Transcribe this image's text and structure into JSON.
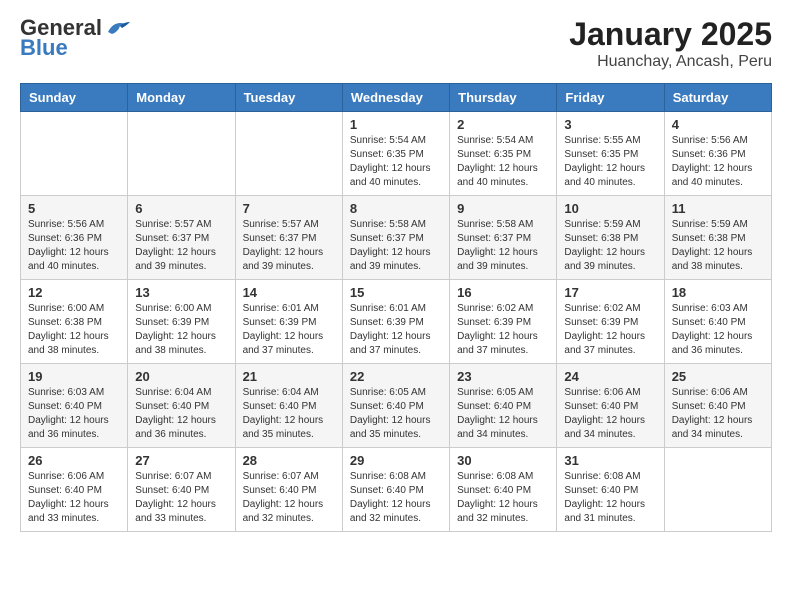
{
  "header": {
    "logo_general": "General",
    "logo_blue": "Blue",
    "title": "January 2025",
    "subtitle": "Huanchay, Ancash, Peru"
  },
  "weekdays": [
    "Sunday",
    "Monday",
    "Tuesday",
    "Wednesday",
    "Thursday",
    "Friday",
    "Saturday"
  ],
  "weeks": [
    [
      {
        "day": "",
        "sunrise": "",
        "sunset": "",
        "daylight": ""
      },
      {
        "day": "",
        "sunrise": "",
        "sunset": "",
        "daylight": ""
      },
      {
        "day": "",
        "sunrise": "",
        "sunset": "",
        "daylight": ""
      },
      {
        "day": "1",
        "sunrise": "Sunrise: 5:54 AM",
        "sunset": "Sunset: 6:35 PM",
        "daylight": "Daylight: 12 hours and 40 minutes."
      },
      {
        "day": "2",
        "sunrise": "Sunrise: 5:54 AM",
        "sunset": "Sunset: 6:35 PM",
        "daylight": "Daylight: 12 hours and 40 minutes."
      },
      {
        "day": "3",
        "sunrise": "Sunrise: 5:55 AM",
        "sunset": "Sunset: 6:35 PM",
        "daylight": "Daylight: 12 hours and 40 minutes."
      },
      {
        "day": "4",
        "sunrise": "Sunrise: 5:56 AM",
        "sunset": "Sunset: 6:36 PM",
        "daylight": "Daylight: 12 hours and 40 minutes."
      }
    ],
    [
      {
        "day": "5",
        "sunrise": "Sunrise: 5:56 AM",
        "sunset": "Sunset: 6:36 PM",
        "daylight": "Daylight: 12 hours and 40 minutes."
      },
      {
        "day": "6",
        "sunrise": "Sunrise: 5:57 AM",
        "sunset": "Sunset: 6:37 PM",
        "daylight": "Daylight: 12 hours and 39 minutes."
      },
      {
        "day": "7",
        "sunrise": "Sunrise: 5:57 AM",
        "sunset": "Sunset: 6:37 PM",
        "daylight": "Daylight: 12 hours and 39 minutes."
      },
      {
        "day": "8",
        "sunrise": "Sunrise: 5:58 AM",
        "sunset": "Sunset: 6:37 PM",
        "daylight": "Daylight: 12 hours and 39 minutes."
      },
      {
        "day": "9",
        "sunrise": "Sunrise: 5:58 AM",
        "sunset": "Sunset: 6:37 PM",
        "daylight": "Daylight: 12 hours and 39 minutes."
      },
      {
        "day": "10",
        "sunrise": "Sunrise: 5:59 AM",
        "sunset": "Sunset: 6:38 PM",
        "daylight": "Daylight: 12 hours and 39 minutes."
      },
      {
        "day": "11",
        "sunrise": "Sunrise: 5:59 AM",
        "sunset": "Sunset: 6:38 PM",
        "daylight": "Daylight: 12 hours and 38 minutes."
      }
    ],
    [
      {
        "day": "12",
        "sunrise": "Sunrise: 6:00 AM",
        "sunset": "Sunset: 6:38 PM",
        "daylight": "Daylight: 12 hours and 38 minutes."
      },
      {
        "day": "13",
        "sunrise": "Sunrise: 6:00 AM",
        "sunset": "Sunset: 6:39 PM",
        "daylight": "Daylight: 12 hours and 38 minutes."
      },
      {
        "day": "14",
        "sunrise": "Sunrise: 6:01 AM",
        "sunset": "Sunset: 6:39 PM",
        "daylight": "Daylight: 12 hours and 37 minutes."
      },
      {
        "day": "15",
        "sunrise": "Sunrise: 6:01 AM",
        "sunset": "Sunset: 6:39 PM",
        "daylight": "Daylight: 12 hours and 37 minutes."
      },
      {
        "day": "16",
        "sunrise": "Sunrise: 6:02 AM",
        "sunset": "Sunset: 6:39 PM",
        "daylight": "Daylight: 12 hours and 37 minutes."
      },
      {
        "day": "17",
        "sunrise": "Sunrise: 6:02 AM",
        "sunset": "Sunset: 6:39 PM",
        "daylight": "Daylight: 12 hours and 37 minutes."
      },
      {
        "day": "18",
        "sunrise": "Sunrise: 6:03 AM",
        "sunset": "Sunset: 6:40 PM",
        "daylight": "Daylight: 12 hours and 36 minutes."
      }
    ],
    [
      {
        "day": "19",
        "sunrise": "Sunrise: 6:03 AM",
        "sunset": "Sunset: 6:40 PM",
        "daylight": "Daylight: 12 hours and 36 minutes."
      },
      {
        "day": "20",
        "sunrise": "Sunrise: 6:04 AM",
        "sunset": "Sunset: 6:40 PM",
        "daylight": "Daylight: 12 hours and 36 minutes."
      },
      {
        "day": "21",
        "sunrise": "Sunrise: 6:04 AM",
        "sunset": "Sunset: 6:40 PM",
        "daylight": "Daylight: 12 hours and 35 minutes."
      },
      {
        "day": "22",
        "sunrise": "Sunrise: 6:05 AM",
        "sunset": "Sunset: 6:40 PM",
        "daylight": "Daylight: 12 hours and 35 minutes."
      },
      {
        "day": "23",
        "sunrise": "Sunrise: 6:05 AM",
        "sunset": "Sunset: 6:40 PM",
        "daylight": "Daylight: 12 hours and 34 minutes."
      },
      {
        "day": "24",
        "sunrise": "Sunrise: 6:06 AM",
        "sunset": "Sunset: 6:40 PM",
        "daylight": "Daylight: 12 hours and 34 minutes."
      },
      {
        "day": "25",
        "sunrise": "Sunrise: 6:06 AM",
        "sunset": "Sunset: 6:40 PM",
        "daylight": "Daylight: 12 hours and 34 minutes."
      }
    ],
    [
      {
        "day": "26",
        "sunrise": "Sunrise: 6:06 AM",
        "sunset": "Sunset: 6:40 PM",
        "daylight": "Daylight: 12 hours and 33 minutes."
      },
      {
        "day": "27",
        "sunrise": "Sunrise: 6:07 AM",
        "sunset": "Sunset: 6:40 PM",
        "daylight": "Daylight: 12 hours and 33 minutes."
      },
      {
        "day": "28",
        "sunrise": "Sunrise: 6:07 AM",
        "sunset": "Sunset: 6:40 PM",
        "daylight": "Daylight: 12 hours and 32 minutes."
      },
      {
        "day": "29",
        "sunrise": "Sunrise: 6:08 AM",
        "sunset": "Sunset: 6:40 PM",
        "daylight": "Daylight: 12 hours and 32 minutes."
      },
      {
        "day": "30",
        "sunrise": "Sunrise: 6:08 AM",
        "sunset": "Sunset: 6:40 PM",
        "daylight": "Daylight: 12 hours and 32 minutes."
      },
      {
        "day": "31",
        "sunrise": "Sunrise: 6:08 AM",
        "sunset": "Sunset: 6:40 PM",
        "daylight": "Daylight: 12 hours and 31 minutes."
      },
      {
        "day": "",
        "sunrise": "",
        "sunset": "",
        "daylight": ""
      }
    ]
  ]
}
